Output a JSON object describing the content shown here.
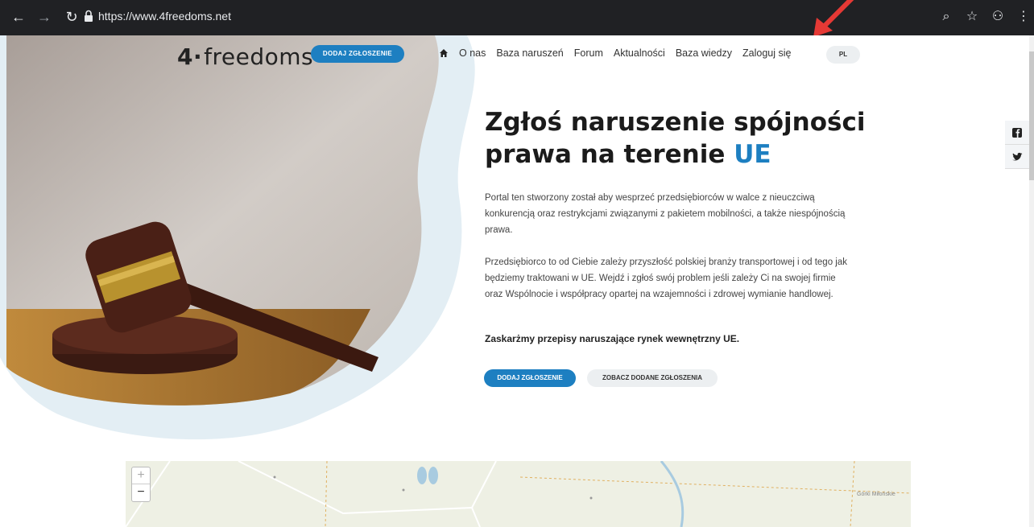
{
  "browser": {
    "url": "https://www.4freedoms.net"
  },
  "header": {
    "logo_text": "freedoms",
    "logo_mark": "4·",
    "report_button": "DODAJ ZGŁOSZENIE",
    "nav_items": [
      "O nas",
      "Baza naruszeń",
      "Forum",
      "Aktualności",
      "Baza wiedzy",
      "Zaloguj się"
    ],
    "language": "PL"
  },
  "hero": {
    "title_line1": "Zgłoś naruszenie spójności",
    "title_line2": "prawa na terenie ",
    "title_accent": "UE",
    "paragraph1": "Portal ten  stworzony został  aby wesprzeć przedsiębiorców w walce z nieuczciwą konkurencją oraz restrykcjami związanymi z pakietem mobilności,  a także niespójnością prawa.",
    "paragraph2": "Przedsiębiorco to od Ciebie zależy przyszłość polskiej branży transportowej i od tego jak będziemy traktowani w UE. Wejdź i zgłoś swój problem jeśli zależy Ci na swojej firmie oraz Wspólnocie i współpracy opartej na wzajemności i zdrowej wymianie handlowej.",
    "paragraph3": "Zaskarżmy przepisy naruszające rynek wewnętrzny UE.",
    "primary_button": "DODAJ ZGŁOSZENIE",
    "secondary_button": "ZOBACZ DODANE ZGŁOSZENIA"
  },
  "map": {
    "zoom_in": "+",
    "zoom_out": "−",
    "place_label": "Górki Miłońskie"
  },
  "colors": {
    "accent": "#1d7fc1",
    "chrome": "#202124",
    "annotation": "#e53935"
  }
}
